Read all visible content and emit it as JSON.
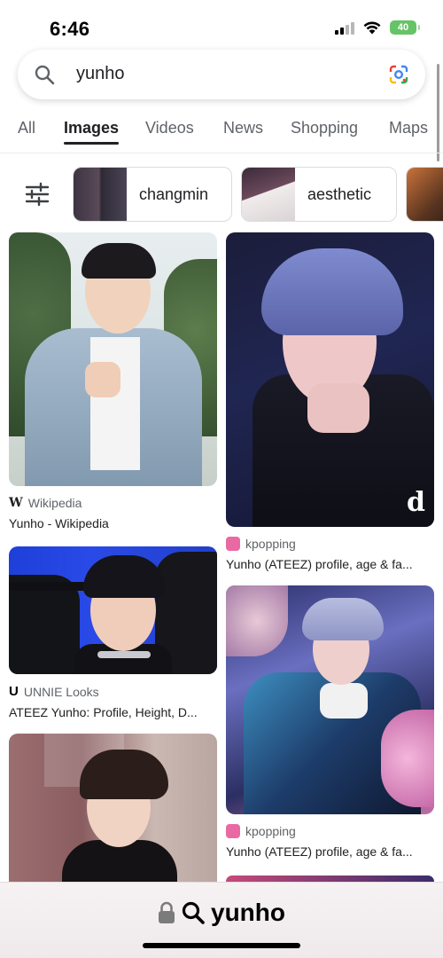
{
  "status_bar": {
    "time": "6:46",
    "battery": "40",
    "signal_bars": 4,
    "signal_active": 2
  },
  "search": {
    "query": "yunho"
  },
  "tabs": [
    {
      "label": "All",
      "active": false
    },
    {
      "label": "Images",
      "active": true
    },
    {
      "label": "Videos",
      "active": false
    },
    {
      "label": "News",
      "active": false
    },
    {
      "label": "Shopping",
      "active": false
    },
    {
      "label": "Maps",
      "active": false
    }
  ],
  "chips": [
    {
      "label": "changmin"
    },
    {
      "label": "aesthetic"
    }
  ],
  "results": [
    {
      "source": "Wikipedia",
      "source_icon": "W",
      "caption": "Yunho - Wikipedia"
    },
    {
      "source": "kpopping",
      "source_icon": "kpopping-icon",
      "caption": "Yunho (ATEEZ) profile, age & fa..."
    },
    {
      "source": "UNNIE Looks",
      "source_icon": "U",
      "caption": "ATEEZ Yunho: Profile, Height, D..."
    },
    {
      "source": "kpopping",
      "source_icon": "kpopping-icon",
      "caption": "Yunho (ATEEZ) profile, age & fa..."
    }
  ],
  "watermark": "d",
  "bottom_bar": {
    "url": "yunho"
  },
  "colors": {
    "accent": "#202124",
    "battery": "#65c466",
    "kpopping": "#e96aa3"
  }
}
